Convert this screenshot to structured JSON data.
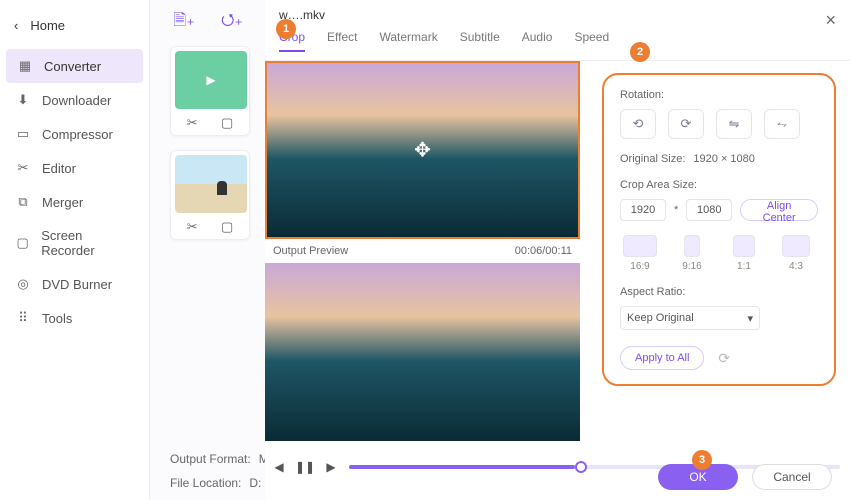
{
  "sidebar": {
    "home": "Home",
    "items": [
      {
        "label": "Converter"
      },
      {
        "label": "Downloader"
      },
      {
        "label": "Compressor"
      },
      {
        "label": "Editor"
      },
      {
        "label": "Merger"
      },
      {
        "label": "Screen Recorder"
      },
      {
        "label": "DVD Burner"
      },
      {
        "label": "Tools"
      }
    ]
  },
  "main": {
    "output_format_label": "Output Format:",
    "output_format_value": "M",
    "file_location_label": "File Location:",
    "file_location_value": "D:"
  },
  "editor": {
    "filename": "w….mkv",
    "tabs": [
      "Crop",
      "Effect",
      "Watermark",
      "Subtitle",
      "Audio",
      "Speed"
    ],
    "output_preview_label": "Output Preview",
    "time": "00:06/00:11",
    "rotation_label": "Rotation:",
    "original_size_label": "Original Size:",
    "original_size_value": "1920 × 1080",
    "crop_area_label": "Crop Area Size:",
    "crop_width": "1920",
    "crop_star": "*",
    "crop_height": "1080",
    "align_center": "Align Center",
    "ratios": [
      "16:9",
      "9:16",
      "1:1",
      "4:3"
    ],
    "aspect_label": "Aspect Ratio:",
    "aspect_value": "Keep Original",
    "apply_all": "Apply to All",
    "ok": "OK",
    "cancel": "Cancel"
  },
  "badges": {
    "b1": "1",
    "b2": "2",
    "b3": "3"
  }
}
